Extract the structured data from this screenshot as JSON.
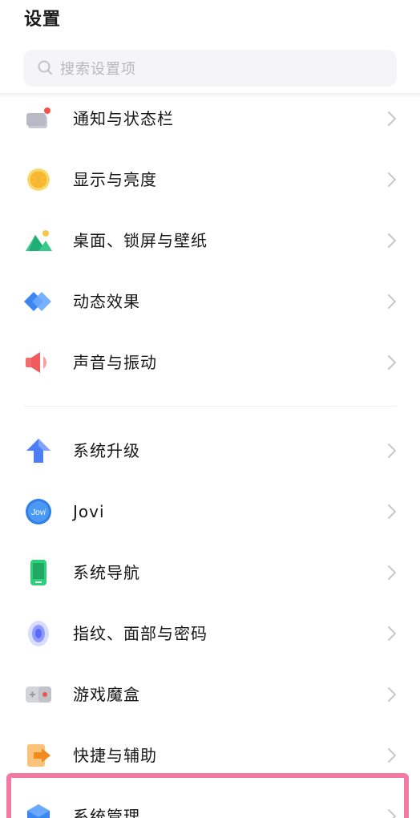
{
  "header": {
    "title": "设置"
  },
  "search": {
    "placeholder": "搜索设置项",
    "icon": "search-icon"
  },
  "groups": [
    {
      "items": [
        {
          "label": "通知与状态栏",
          "icon": "notification-icon"
        },
        {
          "label": "显示与亮度",
          "icon": "brightness-icon"
        },
        {
          "label": "桌面、锁屏与壁纸",
          "icon": "wallpaper-icon"
        },
        {
          "label": "动态效果",
          "icon": "animation-icon"
        },
        {
          "label": "声音与振动",
          "icon": "sound-icon"
        }
      ]
    },
    {
      "items": [
        {
          "label": "系统升级",
          "icon": "upgrade-icon"
        },
        {
          "label": "Jovi",
          "icon": "jovi-icon",
          "icon_text": "Jovi"
        },
        {
          "label": "系统导航",
          "icon": "navigation-icon"
        },
        {
          "label": "指纹、面部与密码",
          "icon": "fingerprint-icon"
        },
        {
          "label": "游戏魔盒",
          "icon": "game-box-icon"
        },
        {
          "label": "快捷与辅助",
          "icon": "shortcut-icon"
        },
        {
          "label": "系统管理",
          "icon": "system-management-icon"
        }
      ]
    }
  ],
  "colors": {
    "highlight": "#f07aa2",
    "chevron": "#c8c8cc",
    "search_bg": "#f5f5f7"
  }
}
